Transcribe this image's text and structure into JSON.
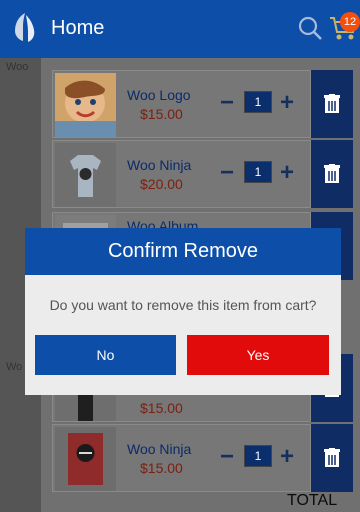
{
  "header": {
    "title": "Home",
    "cart_count": "12"
  },
  "cart": {
    "items": [
      {
        "name": "Woo Logo",
        "price": "$15.00",
        "qty": "1",
        "thumb": "child-portrait"
      },
      {
        "name": "Woo Ninja",
        "price": "$20.00",
        "qty": "1",
        "thumb": "tshirt"
      },
      {
        "name": "Woo Album",
        "price": "",
        "qty": "",
        "thumb": "album"
      },
      {
        "name": "",
        "price": "$15.00",
        "qty": "",
        "thumb": "dark-shirt"
      },
      {
        "name": "Woo Ninja",
        "price": "$15.00",
        "qty": "1",
        "thumb": "ninja-poster"
      }
    ],
    "total_label": "TOTAL"
  },
  "background_peek": {
    "line1": "Woo",
    "line2": "Wo"
  },
  "dialog": {
    "title": "Confirm Remove",
    "message": "Do you want to remove this item from cart?",
    "no_label": "No",
    "yes_label": "Yes"
  },
  "colors": {
    "primary": "#0d4fa8",
    "danger": "#e20b0b",
    "price": "#d33b1a",
    "badge": "#f3500f"
  }
}
